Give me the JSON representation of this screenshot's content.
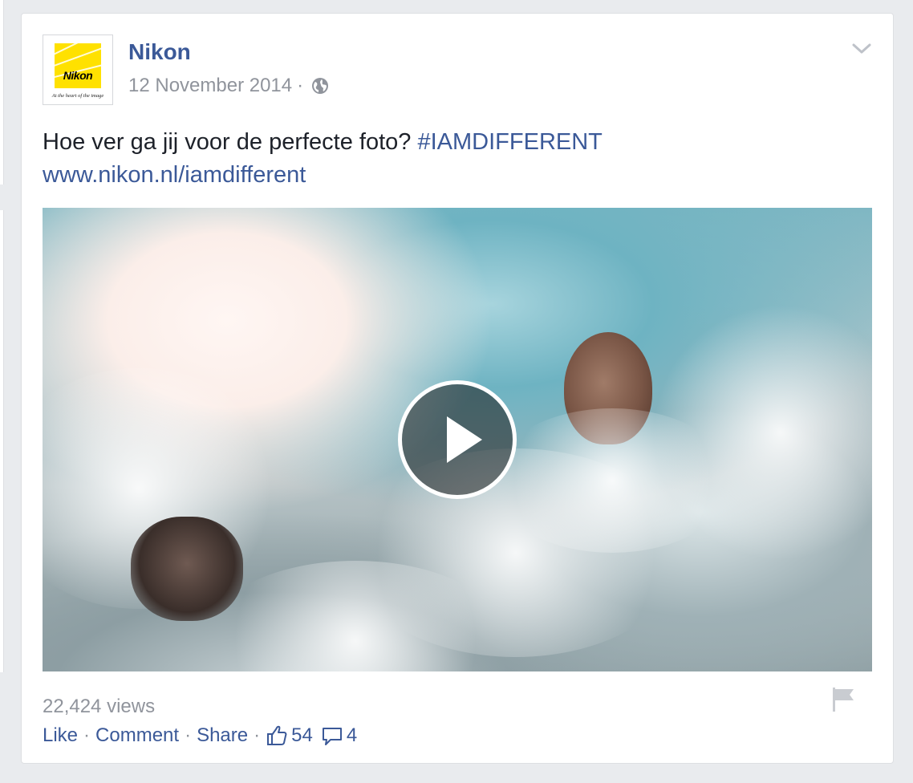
{
  "post": {
    "page_name": "Nikon",
    "logo_text": "Nikon",
    "logo_tagline": "At the heart of the image",
    "date": "12 November 2014",
    "meta_separator": "·",
    "text": "Hoe ver ga jij voor de perfecte foto? ",
    "hashtag": "#IAMDIFFERENT",
    "link": "www.nikon.nl/iamdifferent",
    "views": "22,424 views"
  },
  "actions": {
    "like": "Like",
    "comment": "Comment",
    "share": "Share",
    "separator": "·",
    "like_count": "54",
    "comment_count": "4"
  },
  "icons": {
    "privacy": "globe-icon",
    "menu": "chevron-down-icon",
    "play": "play-icon",
    "report": "flag-icon",
    "likes": "thumbs-up-icon",
    "comments": "speech-bubble-icon"
  },
  "colors": {
    "link_blue": "#3b5998",
    "meta_gray": "#90949c",
    "text": "#1d2129",
    "nikon_yellow": "#ffe100"
  }
}
